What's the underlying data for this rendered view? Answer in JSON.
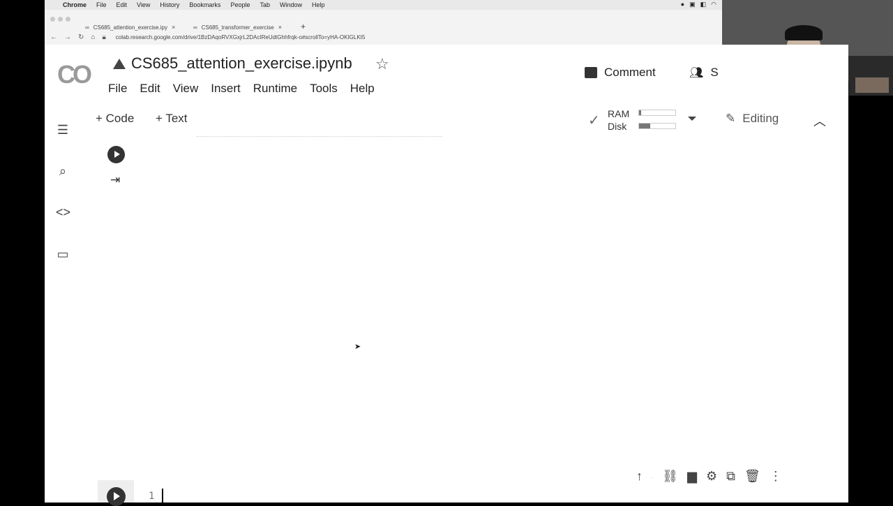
{
  "mac_menubar": {
    "app": "Chrome",
    "items": [
      "File",
      "Edit",
      "View",
      "History",
      "Bookmarks",
      "People",
      "Tab",
      "Window",
      "Help"
    ]
  },
  "browser": {
    "tabs": [
      {
        "label": "CS685_attention_exercise.ipy"
      },
      {
        "label": "CS685_transformer_exercise"
      }
    ],
    "url": "colab.research.google.com/drive/1BzDAqoRVXGxjrL2DAcIReUdtGhhfrqk-o#scrollTo=yHA-OKIGLKI5"
  },
  "colab": {
    "logo": "CO",
    "notebook_title": "CS685_attention_exercise.ipynb",
    "menu": [
      "File",
      "Edit",
      "View",
      "Insert",
      "Runtime",
      "Tools",
      "Help"
    ],
    "comment_label": "Comment",
    "share_label": "S",
    "add_code_label": "+ Code",
    "add_text_label": "+ Text",
    "ram_label": "RAM",
    "disk_label": "Disk",
    "ram_fraction": 0.05,
    "disk_fraction": 0.3,
    "editing_label": "Editing",
    "line_number": "1"
  },
  "icons": {
    "toc": "table-of-contents-icon",
    "search": "search-icon",
    "code": "code-snippets-icon",
    "files": "folder-icon"
  }
}
